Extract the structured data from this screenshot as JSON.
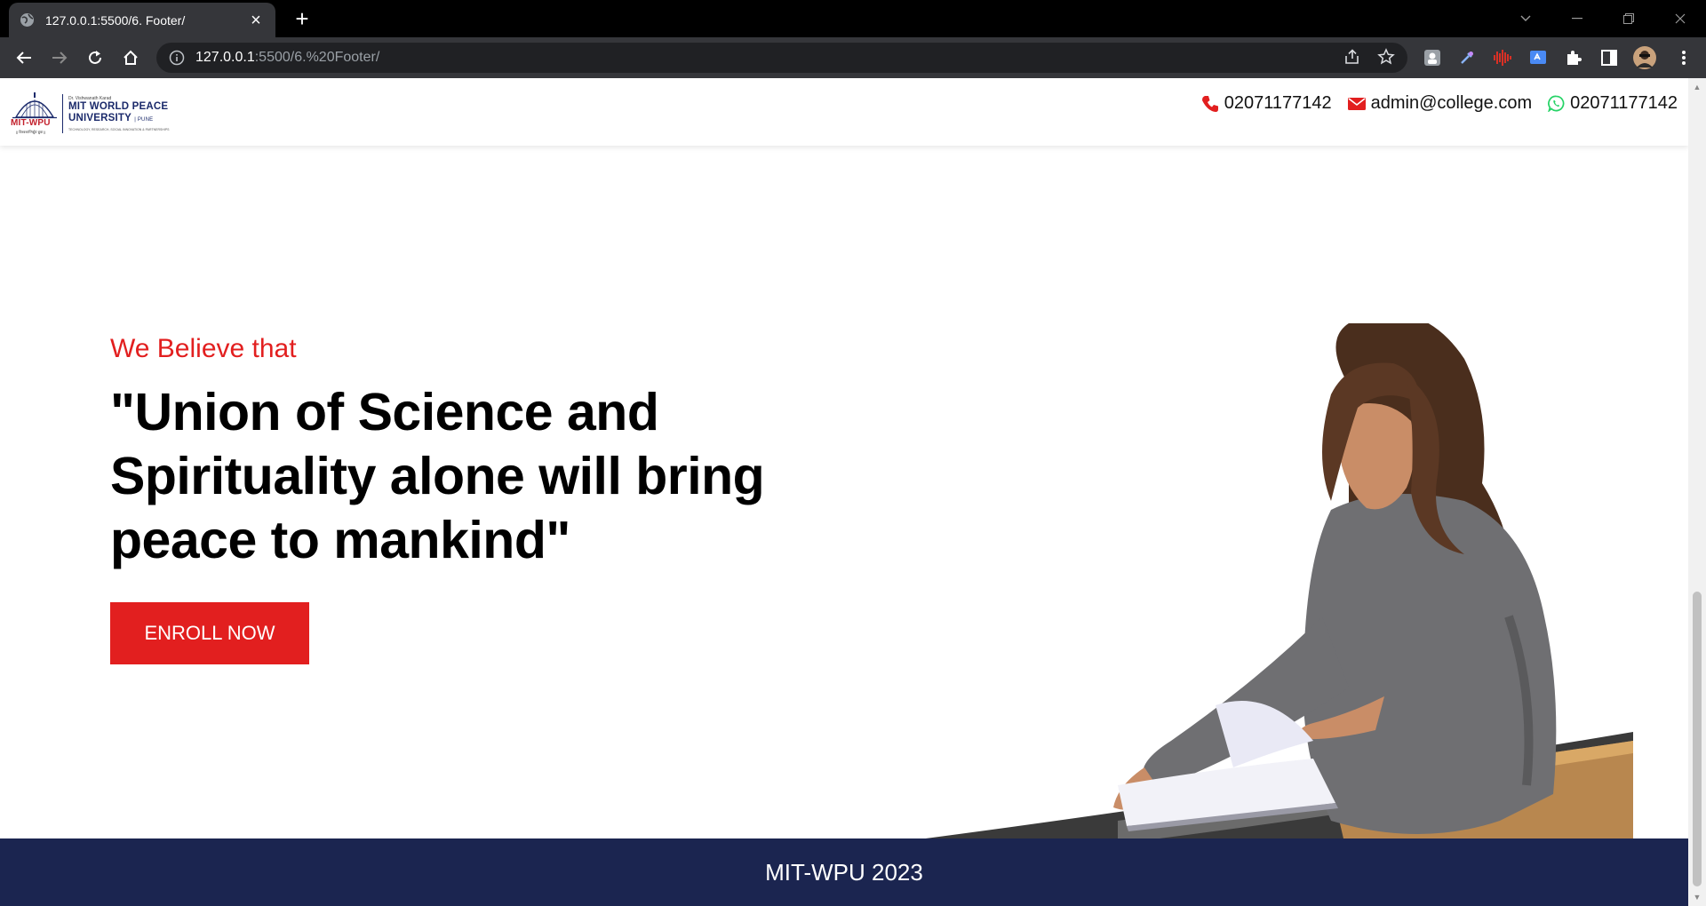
{
  "browser": {
    "tab_title": "127.0.0.1:5500/6. Footer/",
    "url_host": "127.0.0.1",
    "url_path": ":5500/6.%20Footer/",
    "accent": "#35363a"
  },
  "header": {
    "logo": {
      "mark_text": "MIT-WPU",
      "mark_tagline": "|| विश्वशान्तिर्ध्रुवं ध्रुवा ||",
      "small_line": "Dr. Vishwanath Karad",
      "name_line1": "MIT WORLD PEACE",
      "name_line2": "UNIVERSITY",
      "name_suffix": "| PUNE",
      "tagline": "TECHNOLOGY, RESEARCH, SOCIAL INNOVATION & PARTNERSHIPS"
    },
    "phone": "02071177142",
    "email": "admin@college.com",
    "whatsapp": "02071177142"
  },
  "hero": {
    "eyebrow": "We Believe that",
    "headline": "\"Union of Science and Spirituality alone will bring peace to mankind\"",
    "cta_label": "ENROLL NOW"
  },
  "footer": {
    "text": "MIT-WPU 2023"
  },
  "colors": {
    "brand_red": "#e21f1f",
    "brand_navy": "#1b2550"
  }
}
